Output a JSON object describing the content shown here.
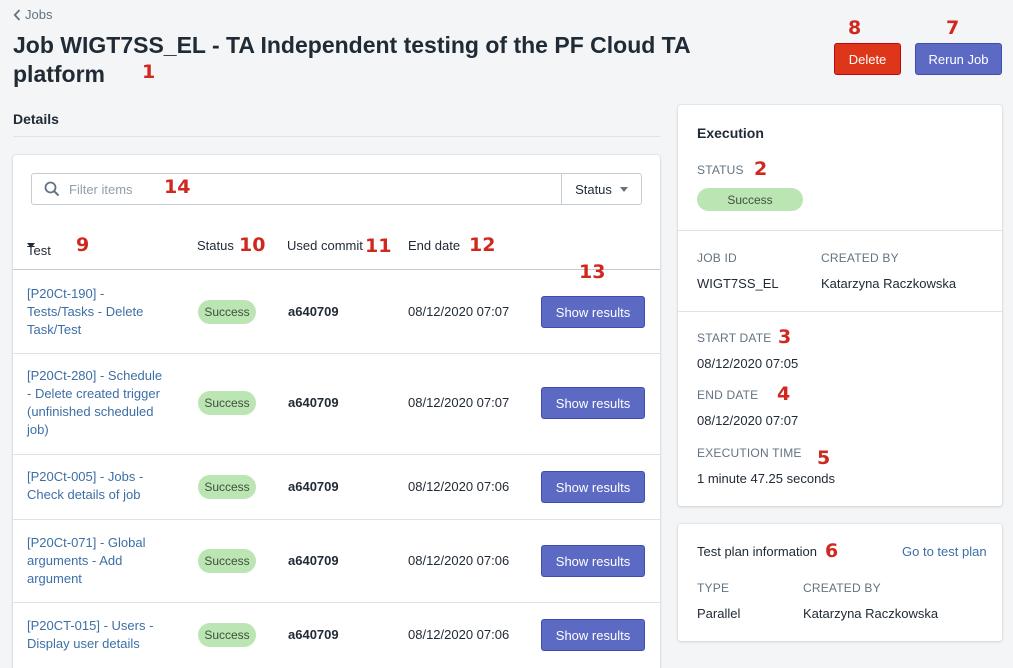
{
  "breadcrumb": {
    "label": "Jobs"
  },
  "page": {
    "title": "Job WIGT7SS_EL - TA Independent testing of the PF Cloud TA platform"
  },
  "actions": {
    "delete_label": "Delete",
    "rerun_label": "Rerun Job"
  },
  "details": {
    "title": "Details",
    "filter": {
      "placeholder": "Filter items",
      "status_label": "Status"
    },
    "columns": {
      "test": "Test",
      "status": "Status",
      "commit": "Used commit",
      "end_date": "End date"
    },
    "rows": [
      {
        "test": "[P20Ct-190] - Tests/Tasks - Delete Task/Test",
        "status": "Success",
        "commit": "a640709",
        "end_date": "08/12/2020 07:07",
        "action": "Show results"
      },
      {
        "test": "[P20Ct-280] - Schedule - Delete created trigger (unfinished scheduled job)",
        "status": "Success",
        "commit": "a640709",
        "end_date": "08/12/2020 07:07",
        "action": "Show results"
      },
      {
        "test": "[P20Ct-005] - Jobs - Check details of job",
        "status": "Success",
        "commit": "a640709",
        "end_date": "08/12/2020 07:06",
        "action": "Show results"
      },
      {
        "test": "[P20Ct-071] - Global arguments - Add argument",
        "status": "Success",
        "commit": "a640709",
        "end_date": "08/12/2020 07:06",
        "action": "Show results"
      },
      {
        "test": "[P20CT-015] - Users - Display user details",
        "status": "Success",
        "commit": "a640709",
        "end_date": "08/12/2020 07:06",
        "action": "Show results"
      }
    ]
  },
  "execution": {
    "title": "Execution",
    "status_label": "Status",
    "status_value": "Success",
    "job_id_label": "Job ID",
    "job_id": "WIGT7SS_EL",
    "created_by_label": "Created by",
    "created_by": "Katarzyna Raczkowska",
    "start_date_label": "Start date",
    "start_date": "08/12/2020 07:05",
    "end_date_label": "End date",
    "end_date": "08/12/2020 07:07",
    "execution_time_label": "Execution time",
    "execution_time": "1 minute 47.25 seconds"
  },
  "test_plan": {
    "title": "Test plan information",
    "link": "Go to test plan",
    "type_label": "Type",
    "type": "Parallel",
    "created_by_label": "Created by",
    "created_by": "Katarzyna Raczkowska"
  },
  "annotations": [
    "1",
    "2",
    "3",
    "4",
    "5",
    "6",
    "7",
    "8",
    "9",
    "10",
    "11",
    "12",
    "13",
    "14"
  ],
  "colors": {
    "primary": "#5c6ac4",
    "danger": "#de3618",
    "success_badge": "#bbe5b3",
    "annotation": "#d0281e",
    "link": "#3d6fa6"
  }
}
